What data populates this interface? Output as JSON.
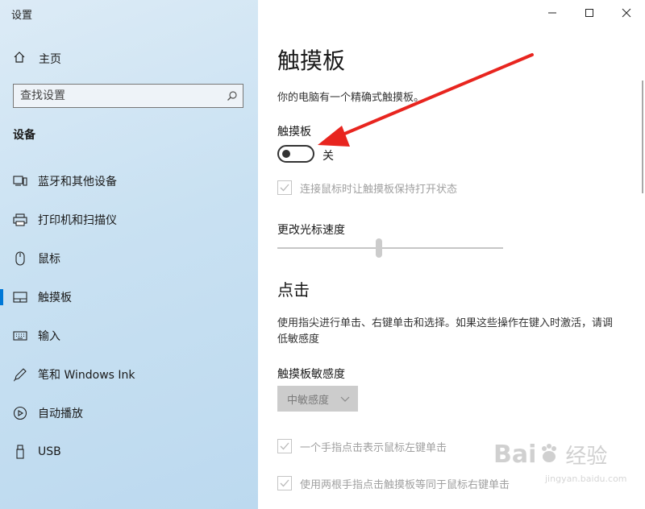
{
  "window": {
    "title": "设置"
  },
  "sidebar": {
    "home_label": "主页",
    "search_placeholder": "查找设置",
    "section_title": "设备",
    "items": [
      {
        "label": "蓝牙和其他设备",
        "icon": "bluetooth-devices-icon"
      },
      {
        "label": "打印机和扫描仪",
        "icon": "printer-icon"
      },
      {
        "label": "鼠标",
        "icon": "mouse-icon"
      },
      {
        "label": "触摸板",
        "icon": "touchpad-icon",
        "active": true
      },
      {
        "label": "输入",
        "icon": "keyboard-icon"
      },
      {
        "label": "笔和 Windows Ink",
        "icon": "pen-icon"
      },
      {
        "label": "自动播放",
        "icon": "autoplay-icon"
      },
      {
        "label": "USB",
        "icon": "usb-icon"
      }
    ]
  },
  "main": {
    "title": "触摸板",
    "description": "你的电脑有一个精确式触摸板。",
    "touchpad_label": "触摸板",
    "toggle": {
      "state_label": "关",
      "on": false
    },
    "keep_on_with_mouse": {
      "label": "连接鼠标时让触摸板保持打开状态",
      "checked": true,
      "disabled": true
    },
    "cursor_speed": {
      "label": "更改光标速度",
      "value_fraction": 0.45
    },
    "taps": {
      "heading": "点击",
      "description": "使用指尖进行单击、右键单击和选择。如果这些操作在键入时激活，请调低敏感度",
      "sensitivity_label": "触摸板敏感度",
      "sensitivity_value": "中敏感度",
      "options": [
        {
          "label": "一个手指点击表示鼠标左键单击",
          "checked": true,
          "disabled": true
        },
        {
          "label": "使用两根手指点击触摸板等同于鼠标右键单击",
          "checked": true,
          "disabled": true
        }
      ]
    }
  },
  "watermark": {
    "brand": "Bai",
    "brand_cn": "经验",
    "url": "jingyan.baidu.com"
  },
  "colors": {
    "accent": "#0078d7",
    "annotation_arrow": "#e8251f"
  }
}
